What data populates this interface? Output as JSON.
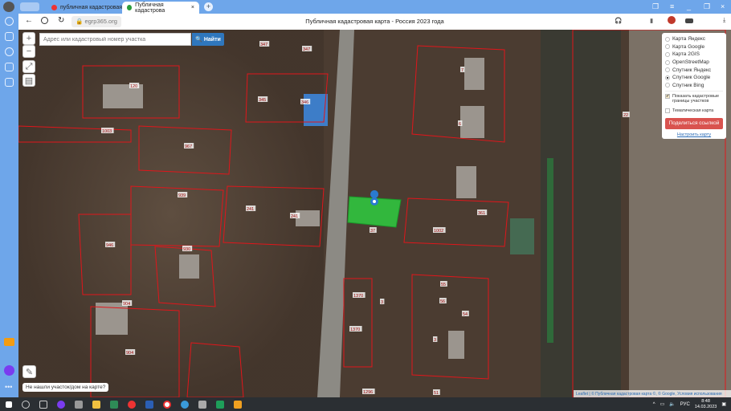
{
  "browser": {
    "tabs": [
      {
        "label": "публичная кадастровая к"
      },
      {
        "label": "Публичная кадастрова"
      }
    ],
    "url": "egrp365.org",
    "page_title": "Публичная кадастровая карта - Россия 2023 года",
    "profile_badge": "Войти"
  },
  "map": {
    "search": {
      "placeholder": "Адрес или кадастровый номер участка",
      "button": "Найти"
    },
    "zoom_in": "+",
    "zoom_out": "−",
    "layers": [
      {
        "label": "Карта Яндекс",
        "selected": false
      },
      {
        "label": "Карта Google",
        "selected": false
      },
      {
        "label": "Карта 2GIS",
        "selected": false
      },
      {
        "label": "OpenStreetMap",
        "selected": false
      },
      {
        "label": "Спутник Яндекс",
        "selected": false
      },
      {
        "label": "Спутник Google",
        "selected": true
      },
      {
        "label": "Спутник Bing",
        "selected": false
      }
    ],
    "show_boundaries": {
      "label": "Показать кадастровые границы участков",
      "checked": true
    },
    "thematic": {
      "label": "Тематическая карта",
      "checked": false
    },
    "share_button": "Поделиться ссылкой",
    "configure_link": "Настроить карту",
    "not_found": "Не нашли участок/дом на карте?",
    "attribution": "Leaflet | © Публичная кадастровая карта ©, © Google, Условия использования",
    "plot_labels": [
      "347",
      "347",
      "120",
      "345",
      "346",
      "7",
      "6",
      "1003",
      "967",
      "22",
      "939",
      "241",
      "241",
      "361",
      "37",
      "1002",
      "946",
      "930",
      "55",
      "1370",
      "3",
      "56",
      "54",
      "904",
      "1370",
      "3",
      "904",
      "1296",
      "51"
    ],
    "highlight_color": "#2ecc40",
    "boundary_color": "#e0161b"
  },
  "taskbar": {
    "lang": "РУС",
    "time": "8:48",
    "date": "14.03.2023"
  }
}
